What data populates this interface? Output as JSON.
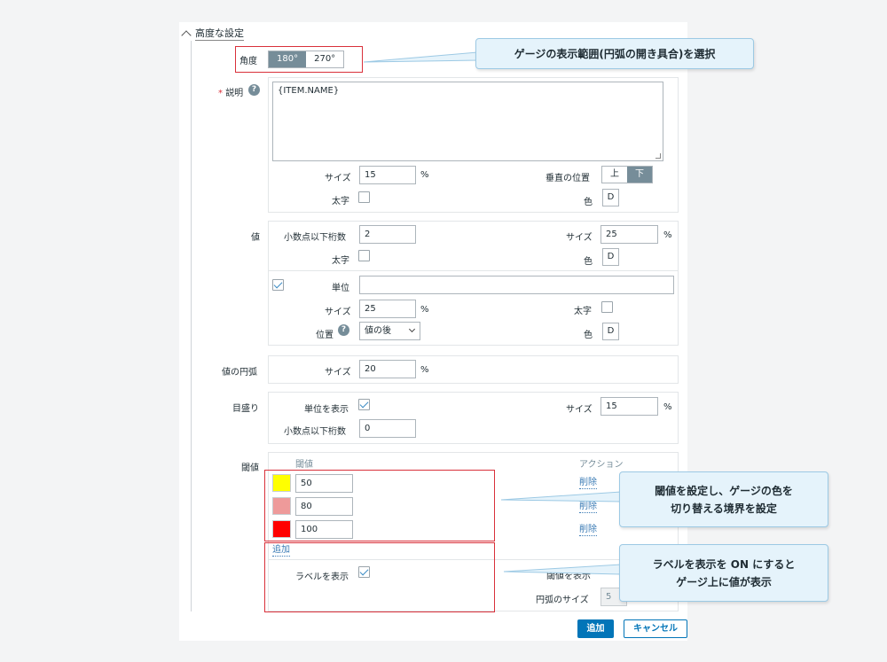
{
  "section": {
    "title": "高度な設定"
  },
  "angle": {
    "label": "角度",
    "options": [
      "180°",
      "270°"
    ],
    "selected": "180°"
  },
  "description": {
    "label": "説明",
    "value": "{ITEM.NAME}",
    "size_label": "サイズ",
    "size_value": "15",
    "pct": "%",
    "bold_label": "太字",
    "vpos_label": "垂直の位置",
    "vpos_options": [
      "上",
      "下"
    ],
    "vpos_selected": "下",
    "color_label": "色",
    "color_value": "D"
  },
  "value": {
    "label": "値",
    "decimals_label": "小数点以下桁数",
    "decimals_value": "2",
    "size_label": "サイズ",
    "size_value": "25",
    "pct": "%",
    "bold_label": "太字",
    "color_label": "色",
    "color_value": "D",
    "units_label": "単位",
    "units_value": "",
    "units_size_label": "サイズ",
    "units_size_value": "25",
    "units_bold_label": "太字",
    "units_pos_label": "位置",
    "units_pos_value": "値の後",
    "units_color_label": "色",
    "units_color_value": "D"
  },
  "value_arc": {
    "label": "値の円弧",
    "size_label": "サイズ",
    "size_value": "20",
    "pct": "%"
  },
  "scale": {
    "label": "目盛り",
    "show_units_label": "単位を表示",
    "size_label": "サイズ",
    "size_value": "15",
    "pct": "%",
    "decimals_label": "小数点以下桁数",
    "decimals_value": "0"
  },
  "thresholds": {
    "label": "閾値",
    "col_threshold": "閾値",
    "col_action": "アクション",
    "rows": [
      {
        "color": "#ffff00",
        "value": "50",
        "action": "削除"
      },
      {
        "color": "#ee9a9a",
        "value": "80",
        "action": "削除"
      },
      {
        "color": "#ff0000",
        "value": "100",
        "action": "削除"
      }
    ],
    "add_label": "追加",
    "show_labels_label": "ラベルを表示",
    "arc_size_label": "円弧のサイズ",
    "arc_size_value": "5",
    "hidden_label": "閾値を表示"
  },
  "footer": {
    "add_button": "追加",
    "cancel_button": "キャンセル"
  },
  "callouts": {
    "angle": "ゲージの表示範囲(円弧の開き具合)を選択",
    "thresholds_line1": "閾値を設定し、ゲージの色を",
    "thresholds_line2": "切り替える境界を設定",
    "labels_line1": "ラベルを表示を ON にすると",
    "labels_line2": "ゲージ上に値が表示"
  },
  "colors": {
    "highlight_red": "#d9303a",
    "callout_bg": "#e5f3fb",
    "primary": "#0275b8",
    "selected_seg": "#768d99"
  }
}
